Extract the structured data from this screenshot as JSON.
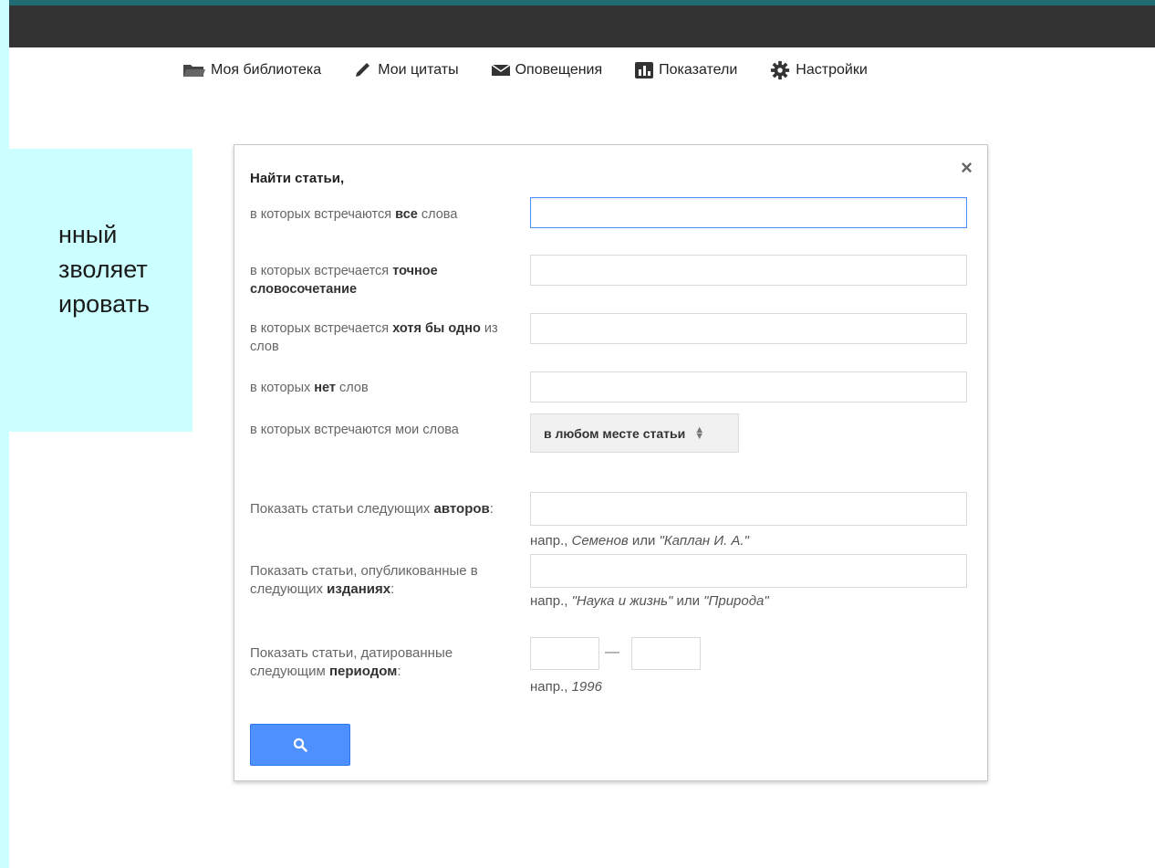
{
  "slide": {
    "lines": [
      "нный",
      "зволяет",
      "ировать"
    ]
  },
  "nav": {
    "items": [
      {
        "label": "Моя библиотека",
        "icon": "folder-icon"
      },
      {
        "label": "Мои цитаты",
        "icon": "pencil-icon"
      },
      {
        "label": "Оповещения",
        "icon": "envelope-icon"
      },
      {
        "label": "Показатели",
        "icon": "bar-chart-icon"
      },
      {
        "label": "Настройки",
        "icon": "gear-icon"
      }
    ]
  },
  "dialog": {
    "title": "Найти статьи,",
    "close": "×",
    "all_words": {
      "pre": "в которых встречаются ",
      "bold": "все",
      "post": " слова",
      "value": ""
    },
    "exact_phrase": {
      "pre": "в которых встречается ",
      "bold": "точное словосочетание",
      "post": "",
      "value": ""
    },
    "any_words": {
      "pre": "в которых встречается ",
      "bold": "хотя бы одно",
      "post": " из слов",
      "value": ""
    },
    "none_words": {
      "pre": "в которых ",
      "bold": "нет",
      "post": " слов",
      "value": ""
    },
    "occurrence": {
      "label": "в которых встречаются мои слова",
      "selected": "в любом месте статьи"
    },
    "authors": {
      "pre": "Показать статьи следующих ",
      "bold": "авторов",
      "post": ":",
      "hint_pre": "напр., ",
      "hint_a": "Семенов",
      "hint_mid": " или ",
      "hint_b": "\"Каплан И. А.\"",
      "value": ""
    },
    "publications": {
      "pre": "Показать статьи, опубликованные в следующих ",
      "bold": "изданиях",
      "post": ":",
      "hint_pre": "напр., ",
      "hint_a": "\"Наука и жизнь\"",
      "hint_mid": " или ",
      "hint_b": "\"Природа\"",
      "value": ""
    },
    "period": {
      "pre": "Показать статьи, датированные следующим ",
      "bold": "периодом",
      "post": ":",
      "dash": "—",
      "hint_pre": "напр., ",
      "hint_a": "1996",
      "from": "",
      "to": ""
    }
  },
  "colors": {
    "accent": "#4d90fe",
    "topbar": "#333333",
    "slide_bg": "#ccffff"
  }
}
